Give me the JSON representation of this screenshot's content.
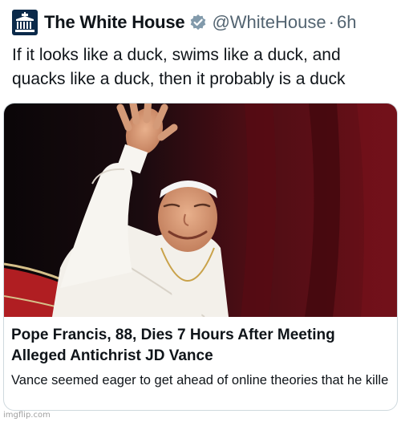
{
  "tweet": {
    "display_name": "The White House",
    "handle": "@WhiteHouse",
    "separator": "·",
    "time": "6h",
    "text": "If it looks like a duck, swims like a duck, and quacks like a duck, then it probably is a duck",
    "avatar_icon": "white-house-logo-icon",
    "verified_icon": "verified-badge-icon",
    "verified_color": "#829aab"
  },
  "link_card": {
    "image_icon": "pope-waving-photo",
    "title": "Pope Francis, 88, Dies 7 Hours After Meeting Alleged Antichrist JD Vance",
    "description": "Vance seemed eager to get ahead of online theories that he killed the Pope—or something like that—given..."
  },
  "watermark": "imgflip.com"
}
